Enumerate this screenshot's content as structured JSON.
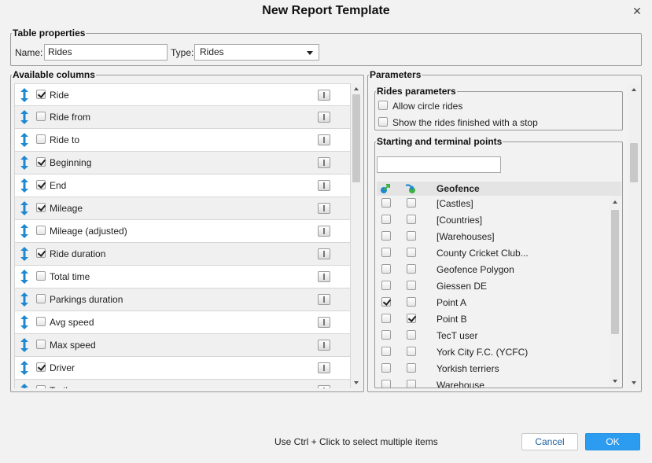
{
  "dialog": {
    "title": "New Report Template",
    "close_symbol": "✕"
  },
  "table_properties": {
    "legend": "Table properties",
    "name_label": "Name:",
    "name_value": "Rides",
    "type_label": "Type:",
    "type_value": "Rides"
  },
  "available_columns": {
    "legend": "Available columns",
    "items": [
      {
        "label": "Ride",
        "checked": true
      },
      {
        "label": "Ride from",
        "checked": false
      },
      {
        "label": "Ride to",
        "checked": false
      },
      {
        "label": "Beginning",
        "checked": true
      },
      {
        "label": "End",
        "checked": true
      },
      {
        "label": "Mileage",
        "checked": true
      },
      {
        "label": "Mileage (adjusted)",
        "checked": false
      },
      {
        "label": "Ride duration",
        "checked": true
      },
      {
        "label": "Total time",
        "checked": false
      },
      {
        "label": "Parkings duration",
        "checked": false
      },
      {
        "label": "Avg speed",
        "checked": false
      },
      {
        "label": "Max speed",
        "checked": false
      },
      {
        "label": "Driver",
        "checked": true
      },
      {
        "label": "Trailer",
        "checked": false
      }
    ]
  },
  "parameters": {
    "legend": "Parameters",
    "rides_parameters": {
      "legend": "Rides parameters",
      "options": [
        {
          "label": "Allow circle rides",
          "checked": false
        },
        {
          "label": "Show the rides finished with a stop",
          "checked": false
        }
      ]
    },
    "points": {
      "legend": "Starting and terminal points",
      "search_value": "",
      "column_header": "Geofence",
      "rows": [
        {
          "label": "[Castles]",
          "start": false,
          "end": false
        },
        {
          "label": "[Countries]",
          "start": false,
          "end": false
        },
        {
          "label": "[Warehouses]",
          "start": false,
          "end": false
        },
        {
          "label": "County Cricket Club...",
          "start": false,
          "end": false
        },
        {
          "label": "Geofence Polygon",
          "start": false,
          "end": false
        },
        {
          "label": "Giessen DE",
          "start": false,
          "end": false
        },
        {
          "label": "Point A",
          "start": true,
          "end": false
        },
        {
          "label": "Point B",
          "start": false,
          "end": true
        },
        {
          "label": "TecT user",
          "start": false,
          "end": false
        },
        {
          "label": "York City F.C. (YCFC)",
          "start": false,
          "end": false
        },
        {
          "label": "Yorkish terriers",
          "start": false,
          "end": false
        },
        {
          "label": "Warehouse",
          "start": false,
          "end": false
        }
      ]
    }
  },
  "footer": {
    "hint": "Use Ctrl + Click to select multiple items",
    "cancel_label": "Cancel",
    "ok_label": "OK"
  },
  "colors": {
    "accent": "#2c9cf0",
    "drag_icon": "#1e88d0",
    "start_icon": "#1e88d0",
    "end_icon": "#3cb043"
  }
}
